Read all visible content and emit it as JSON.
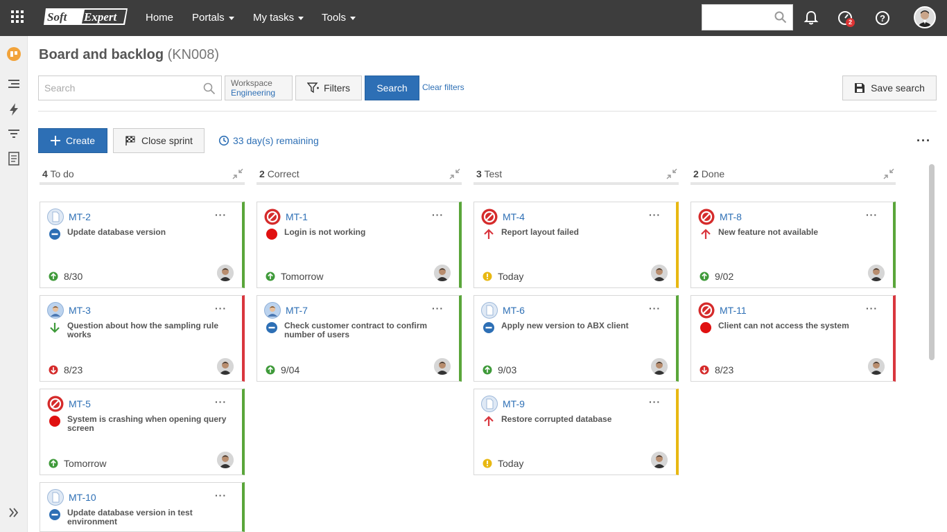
{
  "nav": {
    "logo": "SoftExpert",
    "items": [
      "Home",
      "Portals",
      "My tasks",
      "Tools"
    ],
    "badge_count": "2"
  },
  "page": {
    "title": "Board and backlog",
    "code": "(KN008)"
  },
  "toolbar": {
    "search_placeholder": "Search",
    "workspace_label": "Workspace",
    "workspace_value": "Engineering",
    "filters_label": "Filters",
    "search_label": "Search",
    "clear_filters_label": "Clear filters",
    "save_search_label": "Save search"
  },
  "sprint": {
    "create_label": "Create",
    "close_sprint_label": "Close sprint",
    "remaining_label": "33 day(s) remaining"
  },
  "columns": [
    {
      "count": "4",
      "name": "To do"
    },
    {
      "count": "2",
      "name": "Correct"
    },
    {
      "count": "3",
      "name": "Test"
    },
    {
      "count": "2",
      "name": "Done"
    }
  ],
  "cards": [
    {
      "id": "MT-2",
      "title": "Update database version",
      "date": "8/30",
      "type_icon": "document-icon",
      "priority_icon": "minus-circle-icon",
      "date_icon": "arrow-up-circle-icon",
      "border_color": "#5aa63a"
    },
    {
      "id": "MT-3",
      "title": "Question about how the sampling rule works",
      "date": "8/23",
      "type_icon": "person-icon",
      "priority_icon": "arrow-down-icon",
      "date_icon": "arrow-down-circle-icon",
      "border_color": "#d9363e"
    },
    {
      "id": "MT-5",
      "title": "System is crashing when opening query screen",
      "date": "Tomorrow",
      "type_icon": "blocked-icon",
      "priority_icon": "red-dot-icon",
      "date_icon": "arrow-up-circle-icon",
      "border_color": "#5aa63a"
    },
    {
      "id": "MT-10",
      "title": "Update database version in test environment",
      "date": "",
      "type_icon": "document-icon",
      "priority_icon": "minus-circle-icon",
      "date_icon": "",
      "border_color": "#5aa63a"
    },
    {
      "id": "MT-1",
      "title": "Login is not working",
      "date": "Tomorrow",
      "type_icon": "blocked-icon",
      "priority_icon": "red-dot-icon",
      "date_icon": "arrow-up-circle-icon",
      "border_color": "#5aa63a"
    },
    {
      "id": "MT-7",
      "title": "Check customer contract to confirm number of users",
      "date": "9/04",
      "type_icon": "person-icon",
      "priority_icon": "minus-circle-icon",
      "date_icon": "arrow-up-circle-icon",
      "border_color": "#5aa63a"
    },
    {
      "id": "MT-4",
      "title": "Report layout failed",
      "date": "Today",
      "type_icon": "blocked-icon",
      "priority_icon": "arrow-up-icon",
      "date_icon": "warning-circle-icon",
      "border_color": "#e8b812"
    },
    {
      "id": "MT-6",
      "title": "Apply new version to ABX client",
      "date": "9/03",
      "type_icon": "document-icon",
      "priority_icon": "minus-circle-icon",
      "date_icon": "arrow-up-circle-icon",
      "border_color": "#5aa63a"
    },
    {
      "id": "MT-9",
      "title": "Restore corrupted database",
      "date": "Today",
      "type_icon": "document-icon",
      "priority_icon": "arrow-up-icon",
      "date_icon": "warning-circle-icon",
      "border_color": "#e8b812"
    },
    {
      "id": "MT-8",
      "title": "New feature not available",
      "date": "9/02",
      "type_icon": "blocked-icon",
      "priority_icon": "arrow-up-icon",
      "date_icon": "arrow-up-circle-icon",
      "border_color": "#5aa63a"
    },
    {
      "id": "MT-11",
      "title": "Client can not access the system",
      "date": "8/23",
      "type_icon": "blocked-icon",
      "priority_icon": "red-dot-icon",
      "date_icon": "arrow-down-circle-icon",
      "border_color": "#d9363e"
    }
  ]
}
